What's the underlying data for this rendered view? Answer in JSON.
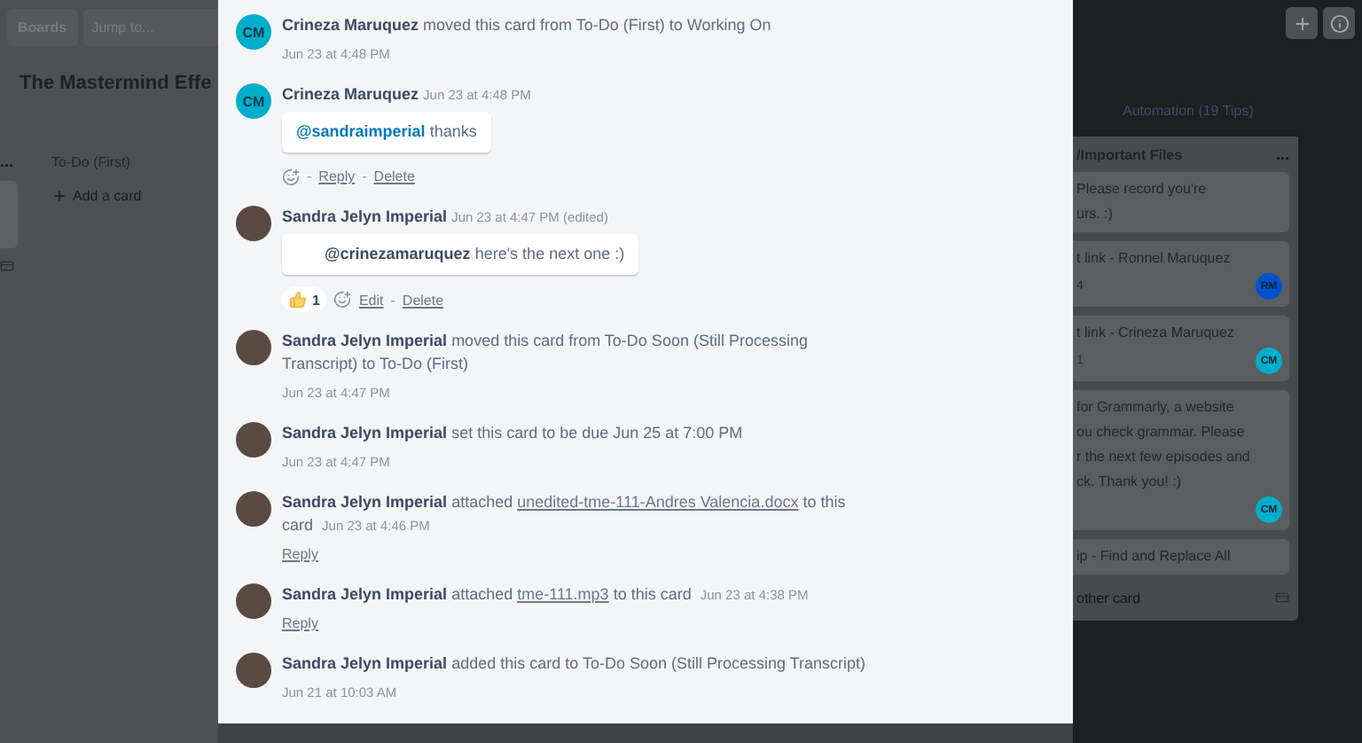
{
  "header": {
    "boards_button": "Boards",
    "search": {
      "placeholder": "Jump to..."
    }
  },
  "board": {
    "title": "The Mastermind Effe",
    "left_list": {
      "menu": "..."
    },
    "list": {
      "title": "To-Do (First)",
      "add_label": "Add a card"
    },
    "automation": "Automation (19 Tips)",
    "right_list": {
      "title": "/Important Files",
      "menu": "...",
      "footer": "other card",
      "cards": [
        {
          "lines": [
            "Please record you're",
            "urs. :)"
          ]
        },
        {
          "lines": [
            "t link - Ronnel Maruquez"
          ],
          "badge": "4",
          "member": {
            "initials": "RM",
            "color": "#0052cc"
          }
        },
        {
          "lines": [
            "t link - Crineza Maruquez"
          ],
          "badge": "1",
          "member": {
            "initials": "CM",
            "color": "#00aecc"
          }
        },
        {
          "lines": [
            "for Grammarly, a website",
            "ou check grammar. Please",
            "r the next few episodes and",
            "ck. Thank you! :)"
          ],
          "member": {
            "initials": "CM",
            "color": "#00aecc"
          }
        },
        {
          "lines": [
            "ip - Find and Replace All"
          ]
        }
      ]
    }
  },
  "activity": {
    "separator": "-",
    "items": [
      {
        "kind": "action",
        "avatar": {
          "kind": "initials",
          "initials": "CM"
        },
        "author": "Crineza Maruquez",
        "text": "moved this card from To-Do (First) to Working On",
        "time": "Jun 23 at 4:48 PM"
      },
      {
        "kind": "comment",
        "avatar": {
          "kind": "initials",
          "initials": "CM"
        },
        "author": "Crineza Maruquez",
        "time": "Jun 23 at 4:48 PM",
        "mention": "@sandraimperial",
        "body": "thanks",
        "indented": false,
        "actions": [
          "Reply",
          "Delete"
        ]
      },
      {
        "kind": "comment",
        "avatar": {
          "kind": "photo"
        },
        "author": "Sandra Jelyn Imperial",
        "time": "Jun 23 at 4:47 PM",
        "edited": "(edited)",
        "mention": "@crinezamaruquez",
        "body": "here's the next one :)",
        "indented": true,
        "reactions": [
          {
            "count": "1"
          }
        ],
        "actions": [
          "Edit",
          "Delete"
        ]
      },
      {
        "kind": "action",
        "avatar": {
          "kind": "photo"
        },
        "author": "Sandra Jelyn Imperial",
        "text": "moved this card from To-Do Soon (Still Processing Transcript) to To-Do (First)",
        "time": "Jun 23 at 4:47 PM"
      },
      {
        "kind": "action",
        "avatar": {
          "kind": "photo"
        },
        "author": "Sandra Jelyn Imperial",
        "text": "set this card to be due Jun 25 at 7:00 PM",
        "time": "Jun 23 at 4:47 PM"
      },
      {
        "kind": "attachment",
        "avatar": {
          "kind": "photo"
        },
        "author": "Sandra Jelyn Imperial",
        "before": "attached",
        "file": "unedited-tme-111-Andres Valencia.docx",
        "after": "to this card",
        "time": "Jun 23 at 4:46 PM",
        "reply": "Reply"
      },
      {
        "kind": "attachment",
        "avatar": {
          "kind": "photo"
        },
        "author": "Sandra Jelyn Imperial",
        "before": "attached",
        "file": "tme-111.mp3",
        "after": "to this card",
        "time": "Jun 23 at 4:38 PM",
        "reply": "Reply"
      },
      {
        "kind": "action",
        "avatar": {
          "kind": "photo"
        },
        "author": "Sandra Jelyn Imperial",
        "text": "added this card to To-Do Soon (Still Processing Transcript)",
        "time": "Jun 21 at 10:03 AM"
      }
    ]
  }
}
